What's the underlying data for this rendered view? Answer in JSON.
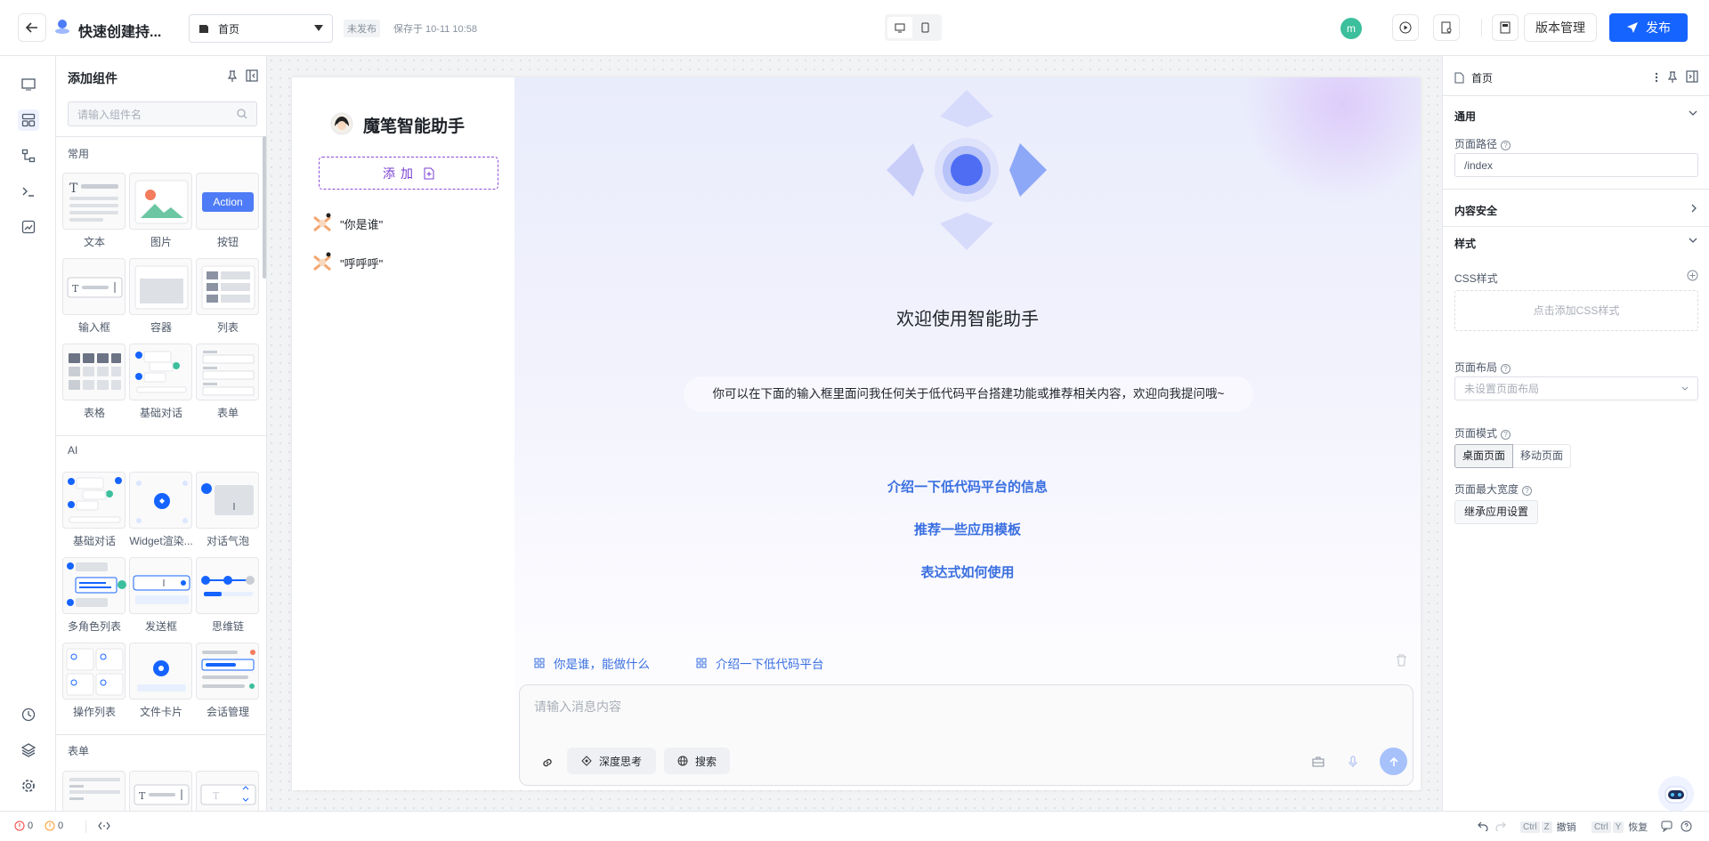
{
  "header": {
    "app_title": "快速创建持...",
    "page_select": "首页",
    "status_badge": "未发布",
    "save_time": "保存于 10-11 10:58",
    "avatar_letter": "m",
    "version_button": "版本管理",
    "publish_button": "发布"
  },
  "components_panel": {
    "title": "添加组件",
    "search_placeholder": "请输入组件名",
    "sections": {
      "common": "常用",
      "ai": "AI",
      "form": "表单"
    },
    "common_items": [
      "文本",
      "图片",
      "按钮",
      "输入框",
      "容器",
      "列表",
      "表格",
      "基础对话",
      "表单"
    ],
    "ai_items": [
      "基础对话",
      "Widget渲染...",
      "对话气泡",
      "多角色列表",
      "发送框",
      "思维链",
      "操作列表",
      "文件卡片",
      "会话管理"
    ],
    "action_preview_label": "Action"
  },
  "canvas": {
    "assistant_name": "魔笔智能助手",
    "add_button": "添加",
    "conversations": [
      "\"你是谁\"",
      "\"呼呼呼\""
    ],
    "welcome_title": "欢迎使用智能助手",
    "welcome_desc": "你可以在下面的输入框里面问我任何关于低代码平台搭建功能或推荐相关内容，欢迎向我提问哦~",
    "suggestions": [
      "介绍一下低代码平台的信息",
      "推荐一些应用模板",
      "表达式如何使用"
    ],
    "quick_prompts": [
      "你是谁，能做什么",
      "介绍一下低代码平台"
    ],
    "input_placeholder": "请输入消息内容",
    "deep_think": "深度思考",
    "search": "搜索"
  },
  "props_panel": {
    "page_name": "首页",
    "general": "通用",
    "page_path_label": "页面路径",
    "page_path_value": "/index",
    "content_security": "内容安全",
    "style": "样式",
    "css_label": "CSS样式",
    "css_add": "点击添加CSS样式",
    "layout_label": "页面布局",
    "layout_placeholder": "未设置页面布局",
    "mode_label": "页面模式",
    "mode_desktop": "桌面页面",
    "mode_mobile": "移动页面",
    "max_width_label": "页面最大宽度",
    "inherit_button": "继承应用设置"
  },
  "bottom_bar": {
    "error_count": "0",
    "warning_count": "0",
    "undo_key_mod": "Ctrl",
    "undo_key": "Z",
    "undo_label": "撤销",
    "redo_key_mod": "Ctrl",
    "redo_key": "Y",
    "redo_label": "恢复"
  },
  "colors": {
    "primary": "#1664ff",
    "suggestion": "#3a6fe0",
    "purple": "#7a3fd3",
    "avatar_green": "#3cbf9c"
  }
}
